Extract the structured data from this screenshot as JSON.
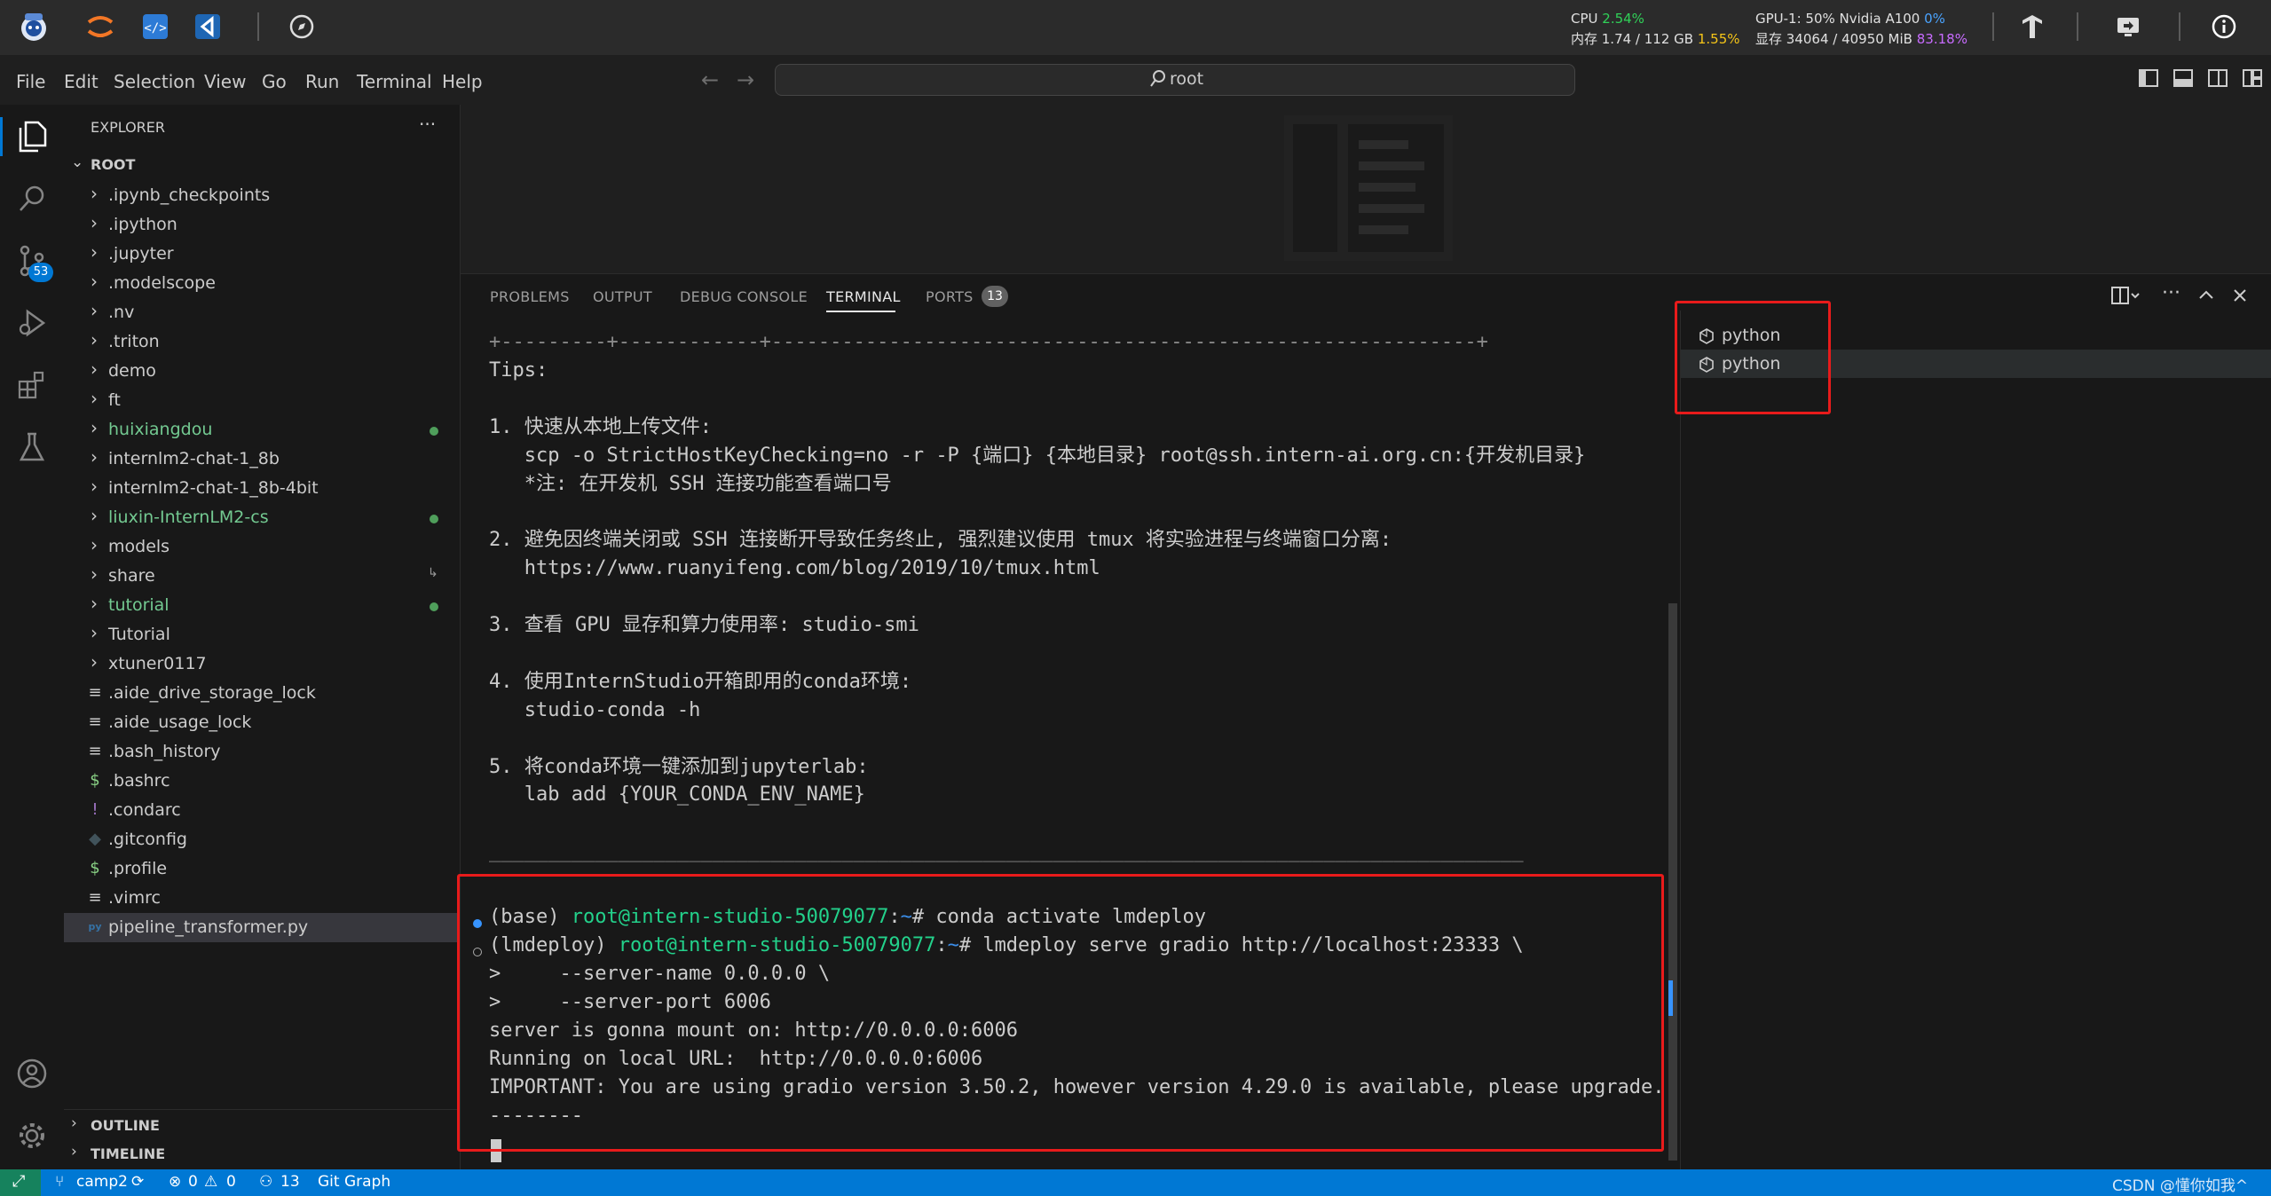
{
  "topbar": {
    "cpu_label": "CPU",
    "cpu_value": "2.54%",
    "mem_label": "内存 1.74 / 112 GB",
    "mem_value": "1.55%",
    "gpu_label": "GPU-1: 50% Nvidia A100",
    "gpu_value": "0%",
    "vram_label": "显存 34064 / 40950 MiB",
    "vram_value": "83.18%"
  },
  "menubar": {
    "items": [
      "File",
      "Edit",
      "Selection",
      "View",
      "Go",
      "Run",
      "Terminal",
      "Help"
    ],
    "search_text": "root"
  },
  "activity": {
    "scm_badge": "53"
  },
  "explorer": {
    "title": "EXPLORER",
    "more": "···",
    "root_label": "ROOT",
    "items": [
      {
        "label": ".ipynb_checkpoints",
        "type": "folder"
      },
      {
        "label": ".ipython",
        "type": "folder"
      },
      {
        "label": ".jupyter",
        "type": "folder"
      },
      {
        "label": ".modelscope",
        "type": "folder"
      },
      {
        "label": ".nv",
        "type": "folder"
      },
      {
        "label": ".triton",
        "type": "folder"
      },
      {
        "label": "demo",
        "type": "folder"
      },
      {
        "label": "ft",
        "type": "folder"
      },
      {
        "label": "huixiangdou",
        "type": "folder",
        "status": "modified"
      },
      {
        "label": "internlm2-chat-1_8b",
        "type": "folder"
      },
      {
        "label": "internlm2-chat-1_8b-4bit",
        "type": "folder"
      },
      {
        "label": "liuxin-InternLM2-cs",
        "type": "folder",
        "status": "modified"
      },
      {
        "label": "models",
        "type": "folder"
      },
      {
        "label": "share",
        "type": "folder",
        "status": "link"
      },
      {
        "label": "tutorial",
        "type": "folder",
        "status": "modified"
      },
      {
        "label": "Tutorial",
        "type": "folder"
      },
      {
        "label": "xtuner0117",
        "type": "folder"
      },
      {
        "label": ".aide_drive_storage_lock",
        "type": "file",
        "icon": "≡"
      },
      {
        "label": ".aide_usage_lock",
        "type": "file",
        "icon": "≡"
      },
      {
        "label": ".bash_history",
        "type": "file",
        "icon": "≡"
      },
      {
        "label": ".bashrc",
        "type": "file",
        "icon": "$"
      },
      {
        "label": ".condarc",
        "type": "file",
        "icon": "!"
      },
      {
        "label": ".gitconfig",
        "type": "file",
        "icon": "◆"
      },
      {
        "label": ".profile",
        "type": "file",
        "icon": "$"
      },
      {
        "label": ".vimrc",
        "type": "file",
        "icon": "≡"
      },
      {
        "label": "pipeline_transformer.py",
        "type": "file",
        "icon": "py",
        "selected": true
      }
    ],
    "outline_label": "OUTLINE",
    "timeline_label": "TIMELINE"
  },
  "panel": {
    "tabs": [
      "PROBLEMS",
      "OUTPUT",
      "DEBUG CONSOLE",
      "TERMINAL",
      "PORTS"
    ],
    "active_tab": "TERMINAL",
    "ports_badge": "13",
    "terminals": [
      "python",
      "python"
    ]
  },
  "terminal": {
    "lines": [
      "+---------+------------+------------------------------------------------------------+",
      "Tips:",
      "",
      "1. 快速从本地上传文件:",
      "   scp -o StrictHostKeyChecking=no -r -P {端口} {本地目录} root@ssh.intern-ai.org.cn:{开发机目录}",
      "   *注: 在开发机 SSH 连接功能查看端口号",
      "",
      "2. 避免因终端关闭或 SSH 连接断开导致任务终止, 强烈建议使用 tmux 将实验进程与终端窗口分离:",
      "   https://www.ruanyifeng.com/blog/2019/10/tmux.html",
      "",
      "3. 查看 GPU 显存和算力使用率: studio-smi",
      "",
      "4. 使用InternStudio开箱即用的conda环境:",
      "   studio-conda -h",
      "",
      "5. 将conda环境一键添加到jupyterlab:",
      "   lab add {YOUR_CONDA_ENV_NAME}",
      "",
      "________________________________________________________________________________________",
      ""
    ],
    "prompt1": {
      "env": "(base) ",
      "host": "root@intern-studio-50079077",
      "sep": ":",
      "path": "~",
      "cmd": "# conda activate lmdeploy"
    },
    "prompt2": {
      "env": "(lmdeploy) ",
      "host": "root@intern-studio-50079077",
      "sep": ":",
      "path": "~",
      "cmd": "# lmdeploy serve gradio http://localhost:23333 \\"
    },
    "output": [
      ">     --server-name 0.0.0.0 \\",
      ">     --server-port 6006",
      "server is gonna mount on: http://0.0.0.0:6006",
      "Running on local URL:  http://0.0.0.0:6006",
      "IMPORTANT: You are using gradio version 3.50.2, however version 4.29.0 is available, please upgrade.",
      "--------"
    ]
  },
  "statusbar": {
    "branch": "camp2",
    "errors": "0",
    "warnings": "0",
    "ports": "13",
    "git_graph": "Git Graph",
    "watermark": "CSDN @懂你如我^"
  }
}
